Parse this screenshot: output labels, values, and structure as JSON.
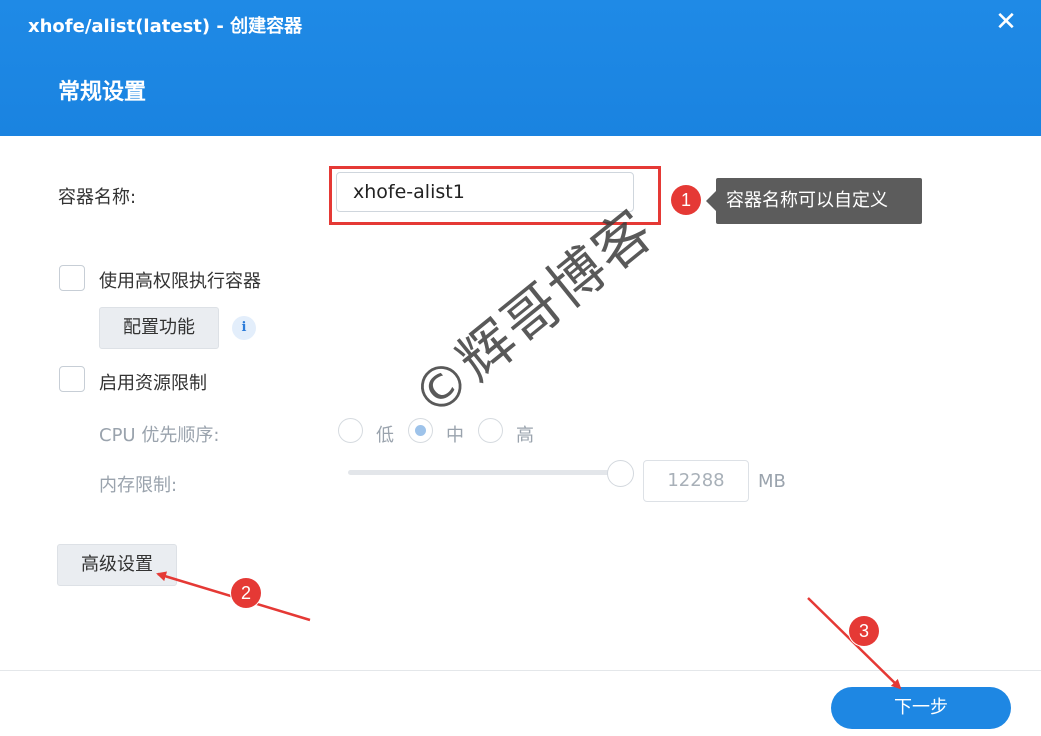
{
  "window": {
    "title": "xhofe/alist(latest) - 创建容器",
    "close_glyph": "✕"
  },
  "section": {
    "title": "常规设置"
  },
  "form": {
    "container_name_label": "容器名称:",
    "container_name_value": "xhofe-alist1",
    "privileged_label": "使用高权限执行容器",
    "privileged_checked": false,
    "config_button": "配置功能",
    "info_glyph": "i",
    "resource_limit_label": "启用资源限制",
    "resource_limit_checked": false,
    "cpu_label": "CPU 优先顺序:",
    "cpu_options": [
      "低",
      "中",
      "高"
    ],
    "cpu_selected": "中",
    "memory_label": "内存限制:",
    "memory_value": "12288",
    "memory_unit": "MB",
    "memory_slider_level": 1.0,
    "advanced_button": "高级设置"
  },
  "footer": {
    "next_button": "下一步"
  },
  "annotations": {
    "tooltip": "容器名称可以自定义",
    "badge_1": "1",
    "badge_2": "2",
    "badge_3": "3",
    "color": "#e53935"
  },
  "watermark": "©辉哥博客",
  "colors": {
    "header": "#1e88e5",
    "primary_button": "#1e87e3",
    "disabled_text": "#9aa3ad"
  }
}
